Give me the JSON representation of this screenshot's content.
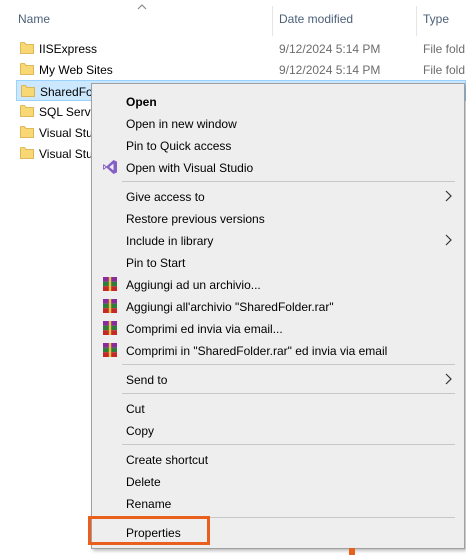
{
  "columns": {
    "name": "Name",
    "date_modified": "Date modified",
    "type": "Type"
  },
  "files": [
    {
      "name": "IISExpress",
      "date": "9/12/2024 5:14 PM",
      "type": "File fold"
    },
    {
      "name": "My Web Sites",
      "date": "9/12/2024 5:14 PM",
      "type": "File fold"
    },
    {
      "name": "SharedFol",
      "date": "",
      "type": "",
      "selected": true
    },
    {
      "name": "SQL Serve",
      "date": "",
      "type": ""
    },
    {
      "name": "Visual Stu",
      "date": "",
      "type": ""
    },
    {
      "name": "Visual Stu",
      "date": "",
      "type": ""
    }
  ],
  "context_menu": {
    "items": [
      {
        "label": "Open",
        "bold": true
      },
      {
        "label": "Open in new window"
      },
      {
        "label": "Pin to Quick access"
      },
      {
        "label": "Open with Visual Studio",
        "icon": "visual-studio-icon"
      },
      {
        "label": "Give access to",
        "submenu": true
      },
      {
        "label": "Restore previous versions"
      },
      {
        "label": "Include in library",
        "submenu": true
      },
      {
        "label": "Pin to Start"
      },
      {
        "label": "Aggiungi ad un archivio...",
        "icon": "winrar-icon"
      },
      {
        "label": "Aggiungi all'archivio \"SharedFolder.rar\"",
        "icon": "winrar-icon"
      },
      {
        "label": "Comprimi ed invia via email...",
        "icon": "winrar-icon"
      },
      {
        "label": "Comprimi in \"SharedFolder.rar\" ed invia via email",
        "icon": "winrar-icon"
      },
      {
        "label": "Send to",
        "submenu": true
      },
      {
        "label": "Cut"
      },
      {
        "label": "Copy"
      },
      {
        "label": "Create shortcut"
      },
      {
        "label": "Delete"
      },
      {
        "label": "Rename"
      },
      {
        "label": "Properties",
        "highlighted": true
      }
    ]
  },
  "colors": {
    "selection": "#cce8ff",
    "highlight": "#e8601c",
    "folder": "#f8d775",
    "visual_studio": "#8661c5"
  }
}
